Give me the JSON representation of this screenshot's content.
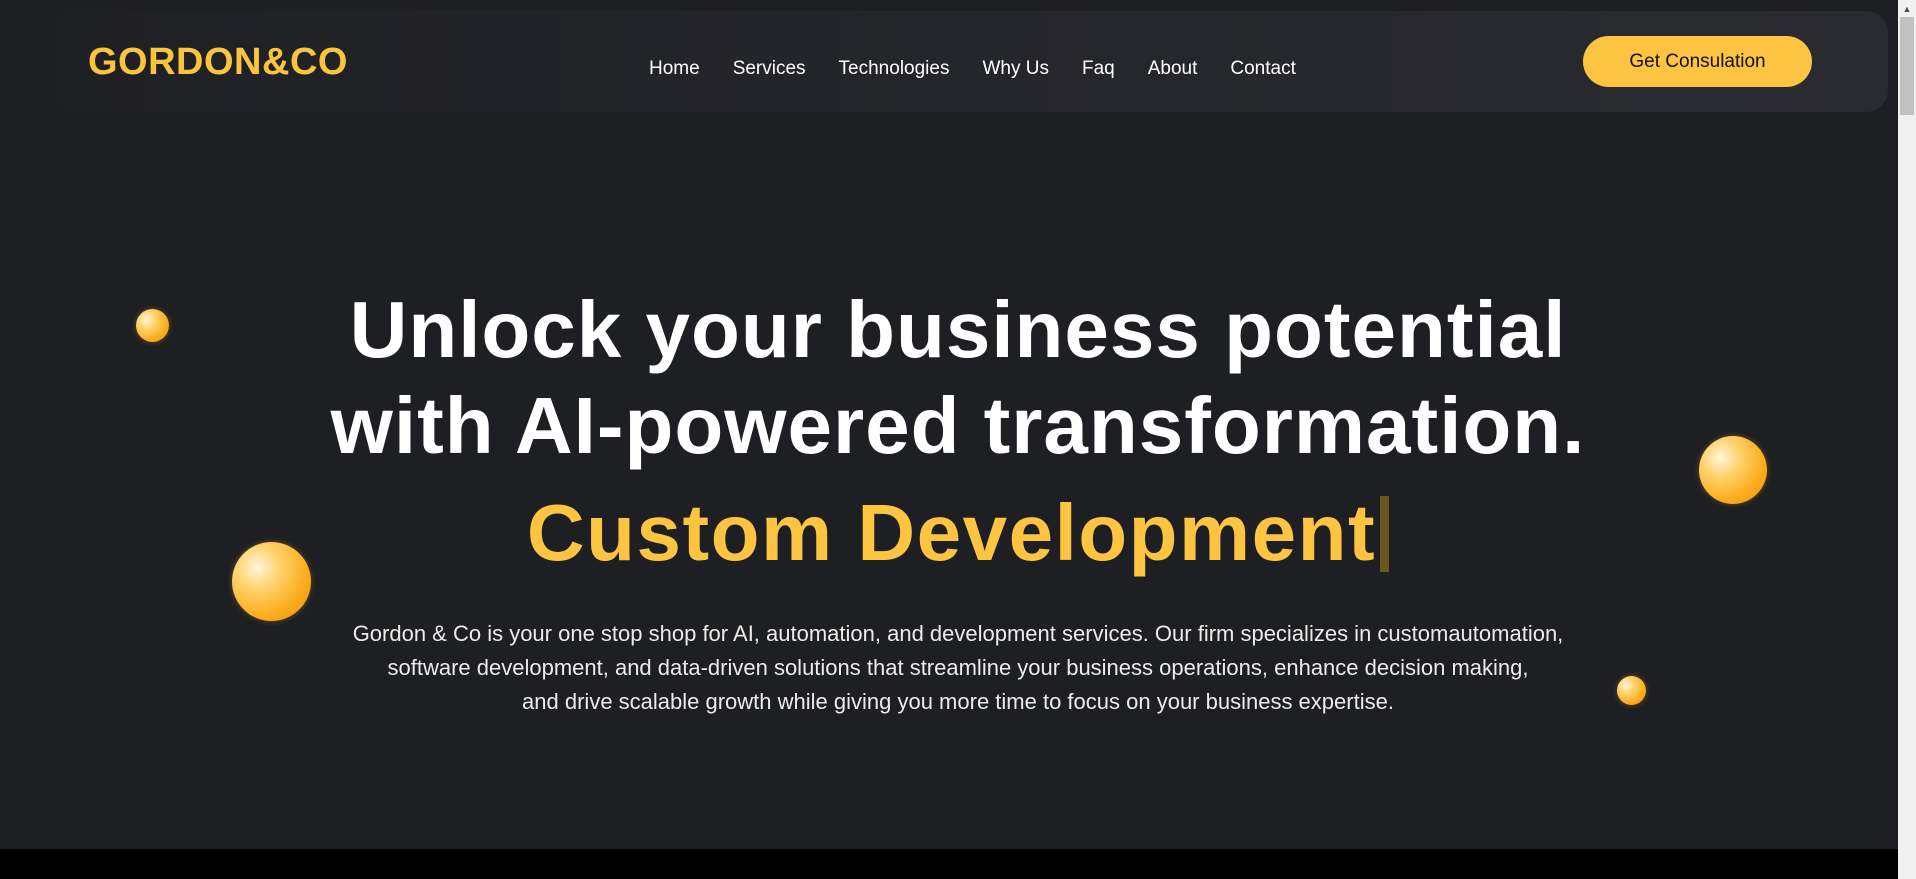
{
  "brand": {
    "logo": "GORDON&CO",
    "accent_color": "#fcc440"
  },
  "nav": {
    "items": [
      {
        "label": "Home"
      },
      {
        "label": "Services"
      },
      {
        "label": "Technologies"
      },
      {
        "label": "Why Us"
      },
      {
        "label": "Faq"
      },
      {
        "label": "About"
      },
      {
        "label": "Contact"
      }
    ],
    "cta_label": "Get Consulation"
  },
  "hero": {
    "title_line1": "Unlock your business potential",
    "title_line2": "with AI-powered transformation.",
    "typed_text": "Custom Development",
    "description_lines": [
      "Gordon & Co is your one stop shop for AI, automation, and development services. Our firm specializes in customautomation,",
      "software development, and data-driven solutions that streamline your business operations, enhance decision making,",
      "and drive scalable growth while giving you more time to focus on your business expertise."
    ]
  },
  "colors": {
    "background": "#1e1f23",
    "navbar": "#26272b",
    "text": "#ffffff",
    "accent": "#fcc440"
  }
}
